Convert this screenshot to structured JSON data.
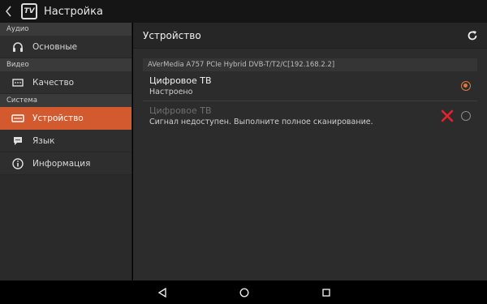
{
  "appbar": {
    "title": "Настройка",
    "app_icon_text": "TV"
  },
  "sidebar": {
    "sections": [
      {
        "header": "Аудио",
        "items": [
          {
            "label": "Основные",
            "icon": "headphones-icon"
          }
        ]
      },
      {
        "header": "Видео",
        "items": [
          {
            "label": "Качество",
            "icon": "video-quality-icon"
          }
        ]
      },
      {
        "header": "Система",
        "items": [
          {
            "label": "Устройство",
            "icon": "device-icon",
            "active": true
          },
          {
            "label": "Язык",
            "icon": "chat-icon"
          },
          {
            "label": "Информация",
            "icon": "info-icon"
          }
        ]
      }
    ]
  },
  "main": {
    "title": "Устройство",
    "device_name": "AVerMedia A757 PCIe Hybrid DVB-T/T2/C[192.168.2.2]",
    "options": [
      {
        "title": "Цифровое ТВ",
        "subtitle": "Настроено",
        "selected": true,
        "disabled": false
      },
      {
        "title": "Цифровое ТВ",
        "subtitle": "Сигнал недоступен. Выполните полное сканирование.",
        "selected": false,
        "disabled": true,
        "error": true
      }
    ]
  },
  "colors": {
    "accent": "#d35a2e",
    "radio_accent": "#e0773f",
    "error": "#e5232e"
  }
}
